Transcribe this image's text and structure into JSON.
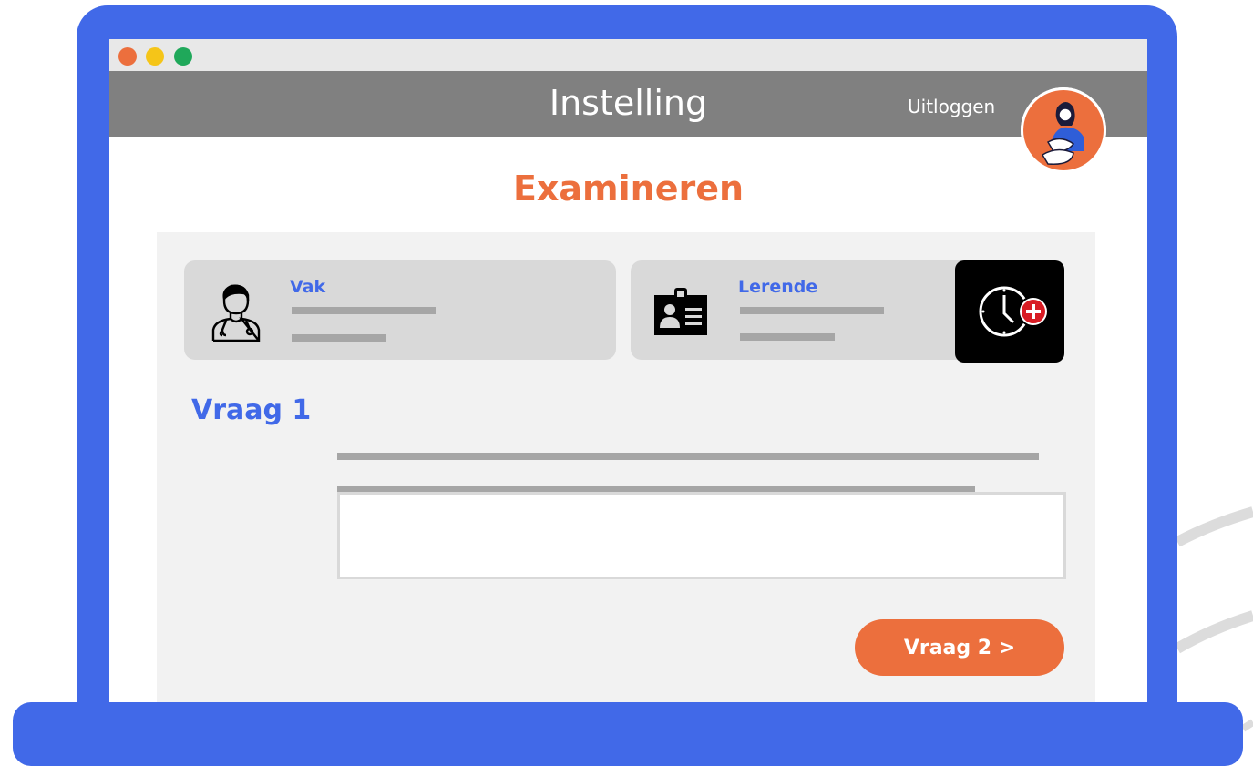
{
  "colors": {
    "frame": "#4169e8",
    "accent_orange": "#ec6f3d",
    "accent_blue": "#4169e8",
    "header_gray": "#808080",
    "dot_red": "#ec6f3d",
    "dot_yellow": "#f5c518",
    "dot_green": "#1fa85a"
  },
  "header": {
    "title": "Instelling",
    "logout_label": "Uitloggen",
    "avatar_icon": "user-avatar-icon"
  },
  "page": {
    "title": "Examineren"
  },
  "cards": {
    "vak": {
      "label": "Vak",
      "icon": "doctor-icon"
    },
    "lerende": {
      "label": "Lerende",
      "icon": "id-badge-icon"
    }
  },
  "timer_button": {
    "icon": "clock-plus-icon"
  },
  "question": {
    "label": "Vraag 1",
    "answer_value": ""
  },
  "next_button": {
    "label": "Vraag 2 >"
  }
}
